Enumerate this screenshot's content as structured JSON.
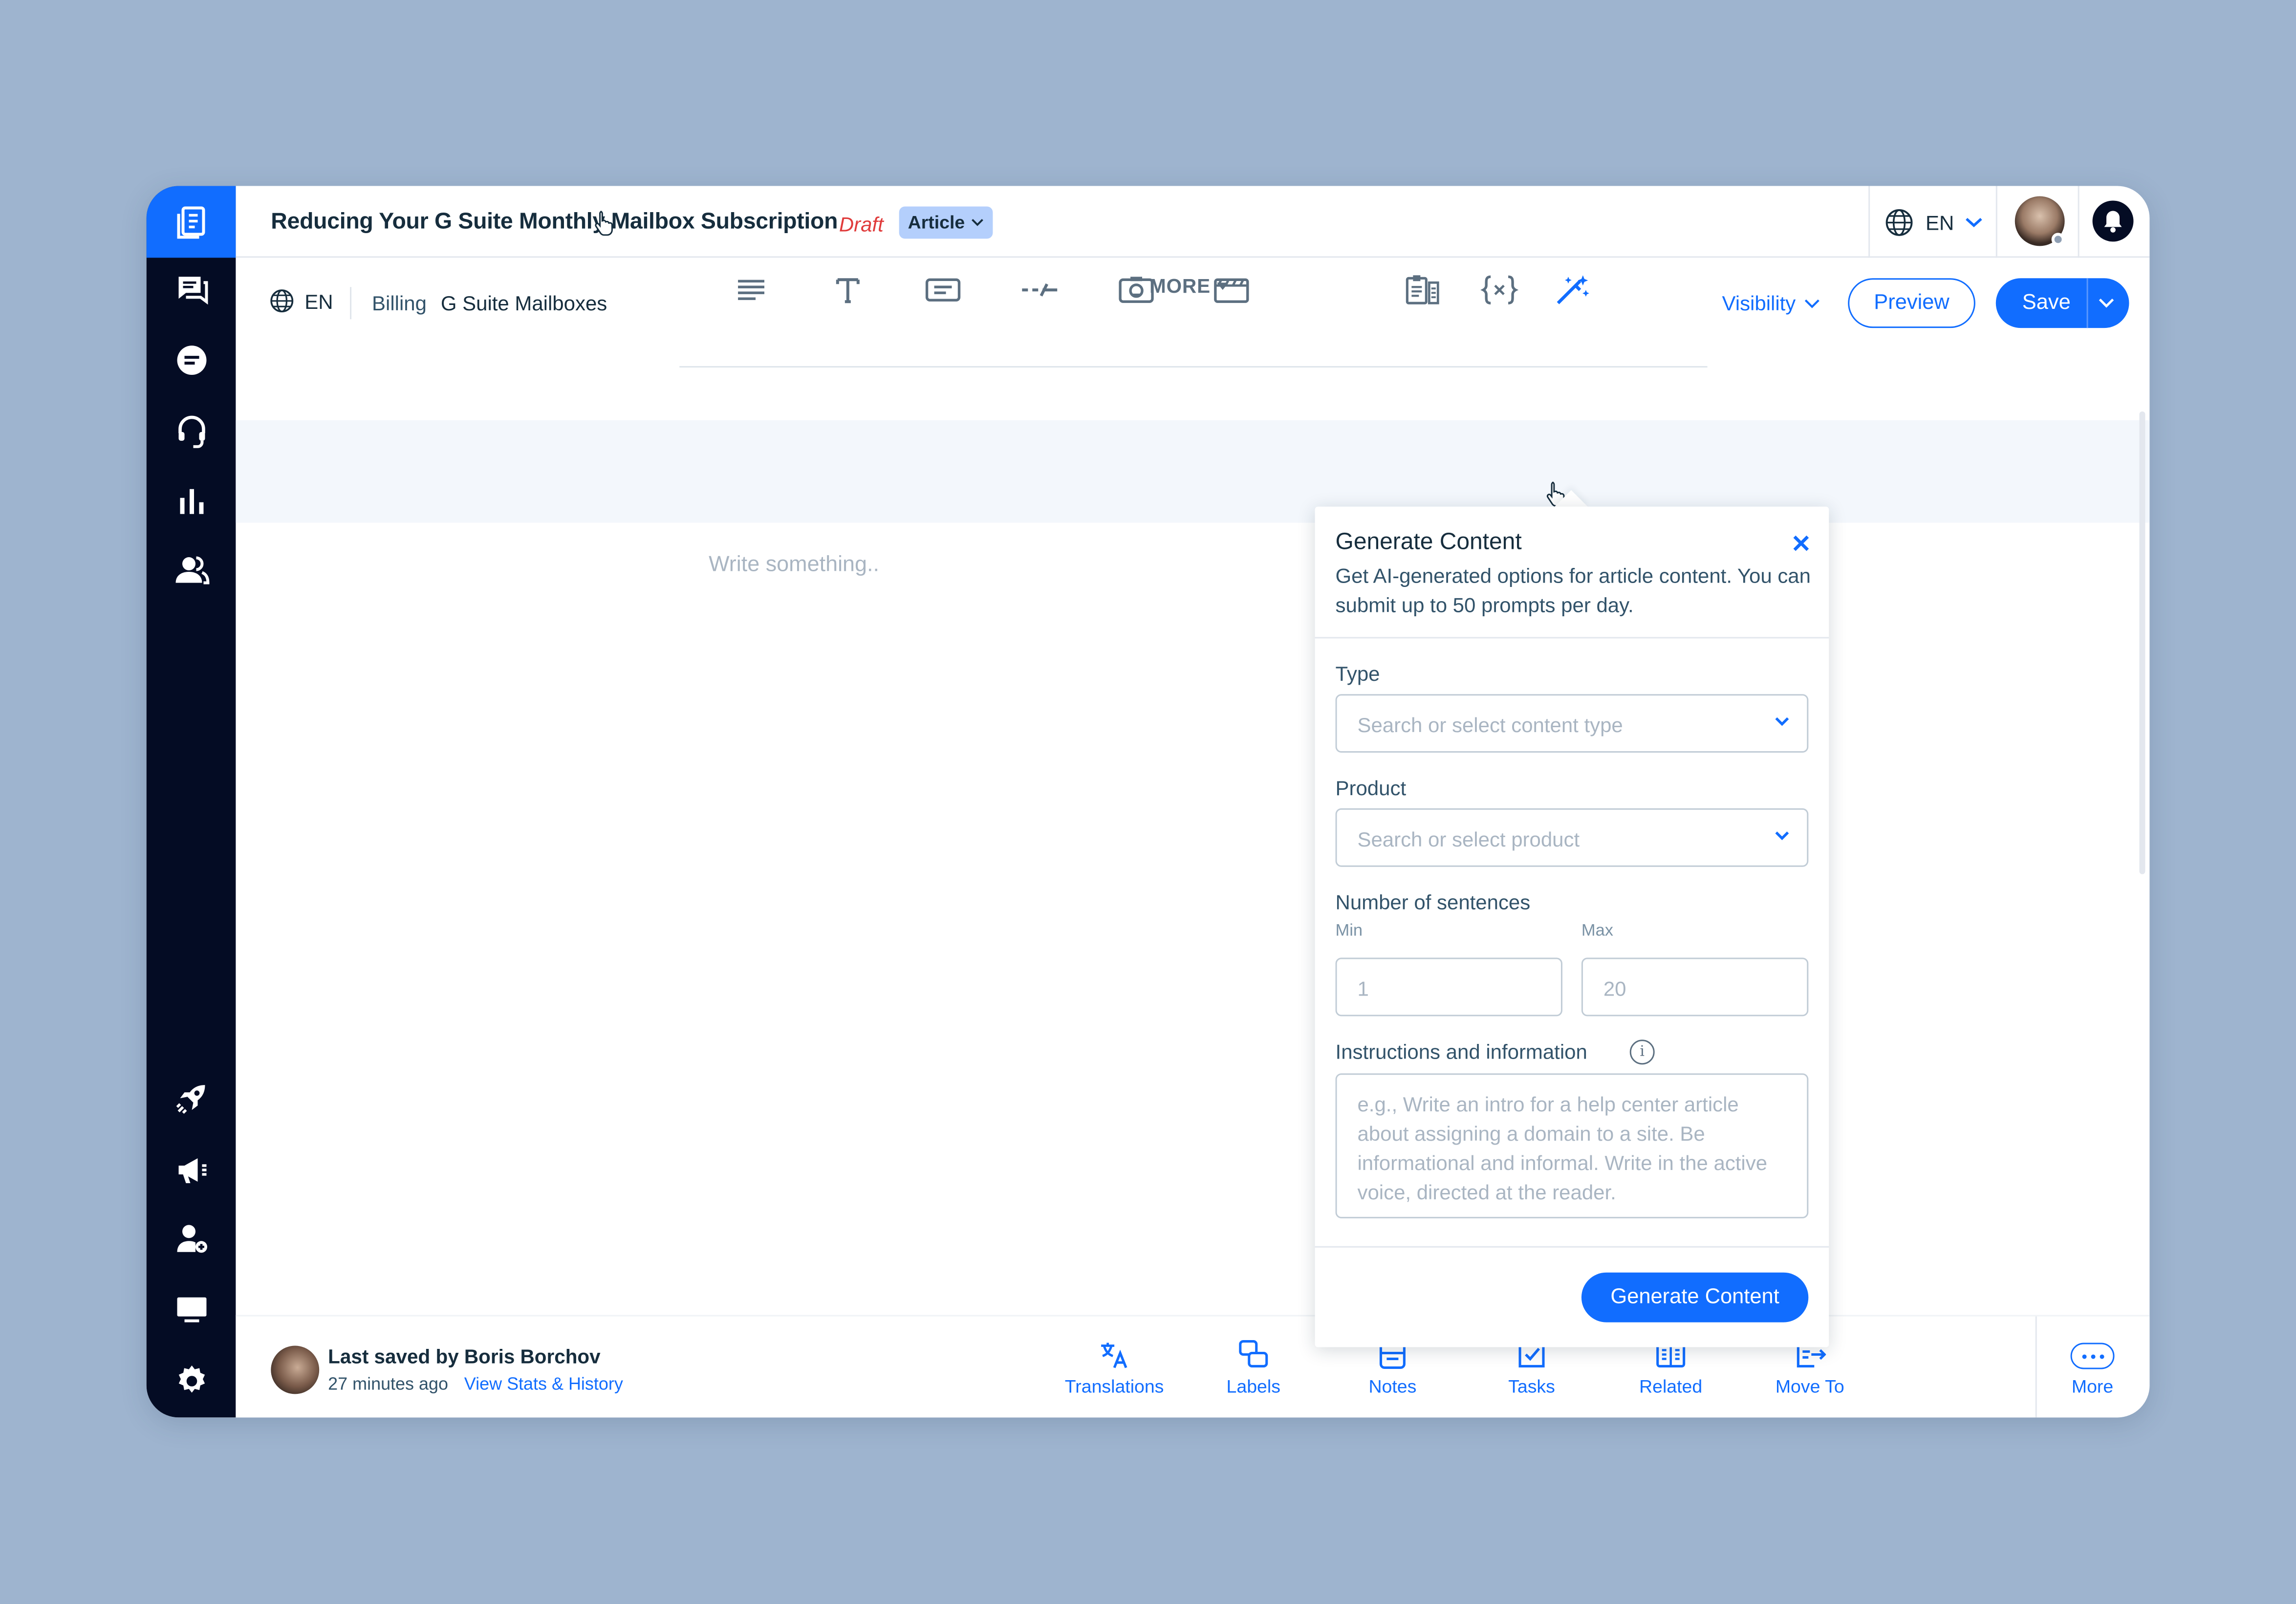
{
  "colors": {
    "accent": "#116dff",
    "sidebar": "#040c24",
    "draft": "#e03b3b",
    "badge": "#b4cffc",
    "background": "#9eb4cf"
  },
  "header": {
    "title": "Reducing Your G Suite Monthly Mailbox Subscription",
    "status": "Draft",
    "type_badge": "Article",
    "language": "EN"
  },
  "subbar": {
    "language": "EN",
    "breadcrumb": [
      "Billing",
      "G Suite Mailboxes"
    ],
    "visibility_label": "Visibility",
    "preview_label": "Preview",
    "save_label": "Save"
  },
  "sidebar": {
    "icons": [
      "articles-icon",
      "tickets-icon",
      "chat-icon",
      "headset-icon",
      "analytics-icon",
      "customers-icon",
      "launch-icon",
      "announcements-icon",
      "add-user-icon",
      "screen-icon",
      "settings-icon"
    ]
  },
  "toolbar": {
    "tools": [
      "paragraph-icon",
      "heading-icon",
      "callout-icon",
      "divider-icon",
      "image-icon",
      "video-icon"
    ],
    "more_label": "MORE",
    "extra_tools": [
      "template-icon",
      "variable-icon",
      "ai-wand-icon"
    ]
  },
  "editor": {
    "placeholder": "Write something.."
  },
  "panel": {
    "title": "Generate Content",
    "description": "Get AI-generated options for article content. You can submit up to 50 prompts per day.",
    "type_label": "Type",
    "type_placeholder": "Search or select content type",
    "product_label": "Product",
    "product_placeholder": "Search or select product",
    "sentences_label": "Number of sentences",
    "min_label": "Min",
    "max_label": "Max",
    "min_placeholder": "1",
    "max_placeholder": "20",
    "instructions_label": "Instructions and information",
    "instructions_placeholder": "e.g., Write an intro for a help center article about assigning a domain to a site. Be informational and informal. Write in the active voice, directed at the reader.",
    "generate_label": "Generate Content"
  },
  "footer": {
    "saved_by": "Last saved by Boris Borchov",
    "saved_ago": "27 minutes ago",
    "stats_link": "View Stats & History",
    "items": [
      {
        "label": "Translations",
        "icon": "translate-icon"
      },
      {
        "label": "Labels",
        "icon": "labels-icon"
      },
      {
        "label": "Notes",
        "icon": "notes-icon"
      },
      {
        "label": "Tasks",
        "icon": "tasks-icon"
      },
      {
        "label": "Related",
        "icon": "related-icon"
      },
      {
        "label": "Move To",
        "icon": "move-to-icon"
      }
    ],
    "more_label": "More"
  }
}
